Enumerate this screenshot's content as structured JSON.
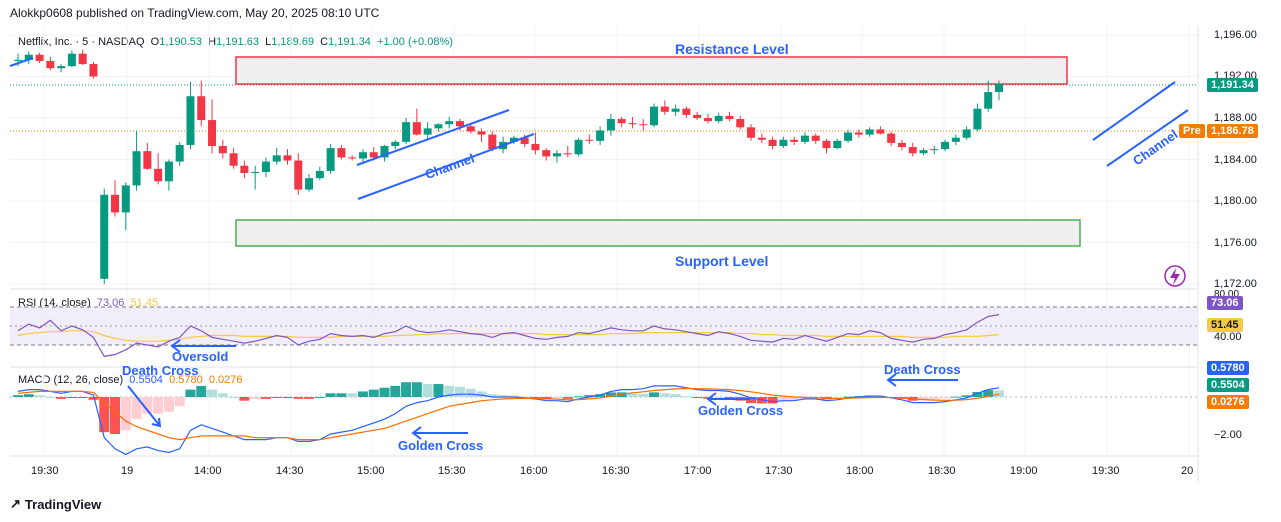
{
  "header": {
    "published": "Alokkp0608 published on TradingView.com, May 20, 2025 08:10 UTC"
  },
  "legend": {
    "symbol": "Netflix, Inc. · 5 · NASDAQ",
    "o_label": "O",
    "o": "1,190.53",
    "h_label": "H",
    "h": "1,191.63",
    "l_label": "L",
    "l": "1,189.69",
    "c_label": "C",
    "c": "1,191.34",
    "change": "+1.00 (+0.08%)"
  },
  "rsi_legend": {
    "name": "RSI (14, close)",
    "value": "73.06",
    "ma": "51.45"
  },
  "macd_legend": {
    "name": "MACD (12, 26, close)",
    "macd": "0.5504",
    "signal": "0.5780",
    "hist": "0.0276"
  },
  "price_axis": {
    "ticks": [
      "1,196.00",
      "1,192.00",
      "1,188.00",
      "1,184.00",
      "1,180.00",
      "1,176.00",
      "1,172.00"
    ],
    "last_price": "1,191.34",
    "pre_label": "Pre",
    "pre_price": "1,186.78"
  },
  "rsi_axis": {
    "top": "80.00",
    "rsi_tag": "73.06",
    "ma_tag": "51.45",
    "bottom": "40.00"
  },
  "macd_axis": {
    "macd_tag": "0.5780",
    "signal_tag": "0.5504",
    "hist_tag": "0.0276",
    "tick": "−2.00"
  },
  "time_axis": [
    "19:30",
    "19",
    "14:00",
    "14:30",
    "15:00",
    "15:30",
    "16:00",
    "16:30",
    "17:00",
    "17:30",
    "18:00",
    "18:30",
    "19:00",
    "19:30",
    "20"
  ],
  "annotations": {
    "resistance": "Resistance Level",
    "support": "Support Level",
    "channel1": "Channel",
    "channel2": "Channel",
    "oversold": "Oversold",
    "death_cross_1": "Death Cross",
    "golden_cross_1": "Golden Cross",
    "golden_cross_2": "Golden Cross",
    "death_cross_2": "Death Cross"
  },
  "brand": "TradingView",
  "colors": {
    "up": "#089981",
    "down": "#f23645",
    "resistance": "#f23645",
    "support": "#4caf50",
    "annotation": "#2962ff",
    "rsi": "#7e57c2",
    "rsi_ma": "#f7c948",
    "macd": "#2962ff",
    "signal": "#ff6d00"
  },
  "chart_data": {
    "type": "candlestick",
    "symbol": "NFLX",
    "interval": "5",
    "ylim": [
      1172,
      1196
    ],
    "candles": [
      [
        1193.5,
        1194.2,
        1193.0,
        1193.6
      ],
      [
        1193.6,
        1194.4,
        1193.2,
        1194.1
      ],
      [
        1194.1,
        1194.3,
        1193.3,
        1193.5
      ],
      [
        1193.5,
        1193.9,
        1192.6,
        1192.8
      ],
      [
        1192.8,
        1193.2,
        1192.4,
        1193.0
      ],
      [
        1193.0,
        1194.5,
        1192.9,
        1194.2
      ],
      [
        1194.2,
        1194.6,
        1193.1,
        1193.2
      ],
      [
        1193.2,
        1193.4,
        1191.8,
        1192.0
      ],
      [
        1172.5,
        1181.2,
        1172.0,
        1180.6
      ],
      [
        1180.6,
        1182.0,
        1178.5,
        1178.9
      ],
      [
        1178.9,
        1181.8,
        1177.2,
        1181.5
      ],
      [
        1181.5,
        1186.8,
        1181.0,
        1184.8
      ],
      [
        1184.8,
        1185.6,
        1183.0,
        1183.1
      ],
      [
        1183.1,
        1184.6,
        1181.6,
        1181.9
      ],
      [
        1181.9,
        1184.0,
        1181.0,
        1183.8
      ],
      [
        1183.8,
        1185.7,
        1183.4,
        1185.4
      ],
      [
        1185.4,
        1191.5,
        1185.0,
        1190.1
      ],
      [
        1190.1,
        1191.6,
        1187.2,
        1187.8
      ],
      [
        1187.8,
        1189.8,
        1184.6,
        1185.3
      ],
      [
        1185.3,
        1185.9,
        1184.1,
        1184.6
      ],
      [
        1184.6,
        1185.1,
        1183.1,
        1183.4
      ],
      [
        1183.4,
        1183.9,
        1182.2,
        1182.7
      ],
      [
        1182.7,
        1183.4,
        1181.1,
        1182.8
      ],
      [
        1182.8,
        1184.2,
        1182.3,
        1183.8
      ],
      [
        1183.8,
        1185.1,
        1183.5,
        1184.4
      ],
      [
        1184.4,
        1185.0,
        1183.5,
        1183.9
      ],
      [
        1183.9,
        1184.6,
        1180.6,
        1181.1
      ],
      [
        1181.1,
        1182.6,
        1180.9,
        1182.2
      ],
      [
        1182.2,
        1183.3,
        1182.0,
        1182.9
      ],
      [
        1182.9,
        1185.5,
        1182.6,
        1185.1
      ],
      [
        1185.1,
        1185.4,
        1184.0,
        1184.2
      ],
      [
        1184.2,
        1184.4,
        1183.9,
        1184.1
      ],
      [
        1184.1,
        1185.0,
        1183.6,
        1184.7
      ],
      [
        1184.7,
        1185.2,
        1183.9,
        1184.2
      ],
      [
        1184.2,
        1185.4,
        1183.8,
        1185.3
      ],
      [
        1185.3,
        1185.9,
        1185.0,
        1185.7
      ],
      [
        1185.7,
        1188.0,
        1185.5,
        1187.6
      ],
      [
        1187.6,
        1188.9,
        1186.3,
        1186.4
      ],
      [
        1186.4,
        1187.6,
        1186.0,
        1187.0
      ],
      [
        1187.0,
        1187.5,
        1186.7,
        1187.4
      ],
      [
        1187.4,
        1188.1,
        1187.0,
        1187.7
      ],
      [
        1187.7,
        1187.9,
        1186.8,
        1187.2
      ],
      [
        1187.2,
        1187.4,
        1186.5,
        1186.7
      ],
      [
        1186.7,
        1187.0,
        1185.7,
        1186.4
      ],
      [
        1186.4,
        1186.7,
        1184.8,
        1185.0
      ],
      [
        1185.0,
        1186.2,
        1184.6,
        1185.7
      ],
      [
        1185.7,
        1186.3,
        1185.5,
        1186.1
      ],
      [
        1186.1,
        1186.4,
        1185.2,
        1185.5
      ],
      [
        1185.5,
        1186.6,
        1184.5,
        1184.9
      ],
      [
        1184.9,
        1185.1,
        1183.9,
        1184.3
      ],
      [
        1184.3,
        1184.9,
        1183.7,
        1184.6
      ],
      [
        1184.6,
        1185.3,
        1184.2,
        1184.5
      ],
      [
        1184.5,
        1186.1,
        1184.3,
        1185.9
      ],
      [
        1185.9,
        1186.4,
        1185.5,
        1185.8
      ],
      [
        1185.8,
        1187.2,
        1185.4,
        1186.8
      ],
      [
        1186.8,
        1188.4,
        1186.3,
        1187.9
      ],
      [
        1187.9,
        1188.1,
        1187.1,
        1187.5
      ],
      [
        1187.5,
        1188.1,
        1187.0,
        1187.4
      ],
      [
        1187.4,
        1187.9,
        1186.8,
        1187.3
      ],
      [
        1187.3,
        1189.4,
        1187.1,
        1189.1
      ],
      [
        1189.1,
        1189.7,
        1188.3,
        1188.6
      ],
      [
        1188.6,
        1189.3,
        1188.2,
        1188.9
      ],
      [
        1188.9,
        1189.1,
        1188.0,
        1188.3
      ],
      [
        1188.3,
        1188.6,
        1187.8,
        1188.0
      ],
      [
        1188.0,
        1188.4,
        1187.5,
        1187.7
      ],
      [
        1187.7,
        1188.5,
        1187.5,
        1188.2
      ],
      [
        1188.2,
        1188.6,
        1187.7,
        1187.9
      ],
      [
        1187.9,
        1188.2,
        1186.9,
        1187.1
      ],
      [
        1187.1,
        1187.4,
        1185.8,
        1186.1
      ],
      [
        1186.1,
        1186.5,
        1185.6,
        1185.9
      ],
      [
        1185.9,
        1186.2,
        1185.0,
        1185.3
      ],
      [
        1185.3,
        1186.2,
        1185.1,
        1185.9
      ],
      [
        1185.9,
        1186.2,
        1185.4,
        1185.7
      ],
      [
        1185.7,
        1186.6,
        1185.5,
        1186.3
      ],
      [
        1186.3,
        1186.5,
        1185.5,
        1185.8
      ],
      [
        1185.8,
        1186.0,
        1184.6,
        1185.1
      ],
      [
        1185.1,
        1186.0,
        1185.0,
        1185.8
      ],
      [
        1185.8,
        1186.9,
        1185.6,
        1186.6
      ],
      [
        1186.6,
        1186.9,
        1186.1,
        1186.4
      ],
      [
        1186.4,
        1187.1,
        1186.2,
        1186.9
      ],
      [
        1186.9,
        1187.2,
        1186.4,
        1186.5
      ],
      [
        1186.5,
        1186.7,
        1185.3,
        1185.6
      ],
      [
        1185.6,
        1185.9,
        1184.9,
        1185.2
      ],
      [
        1185.2,
        1185.6,
        1184.3,
        1184.6
      ],
      [
        1184.6,
        1185.1,
        1184.4,
        1184.9
      ],
      [
        1184.9,
        1185.3,
        1184.5,
        1185.0
      ],
      [
        1185.0,
        1185.9,
        1184.8,
        1185.7
      ],
      [
        1185.7,
        1186.4,
        1185.4,
        1186.1
      ],
      [
        1186.1,
        1187.2,
        1185.9,
        1186.9
      ],
      [
        1186.9,
        1189.4,
        1186.7,
        1188.9
      ],
      [
        1188.9,
        1191.6,
        1188.6,
        1190.5
      ],
      [
        1190.5,
        1191.6,
        1189.7,
        1191.3
      ]
    ],
    "resistance_zone": [
      1191.2,
      1194.9
    ],
    "support_zone": [
      1175.9,
      1179.8
    ]
  }
}
